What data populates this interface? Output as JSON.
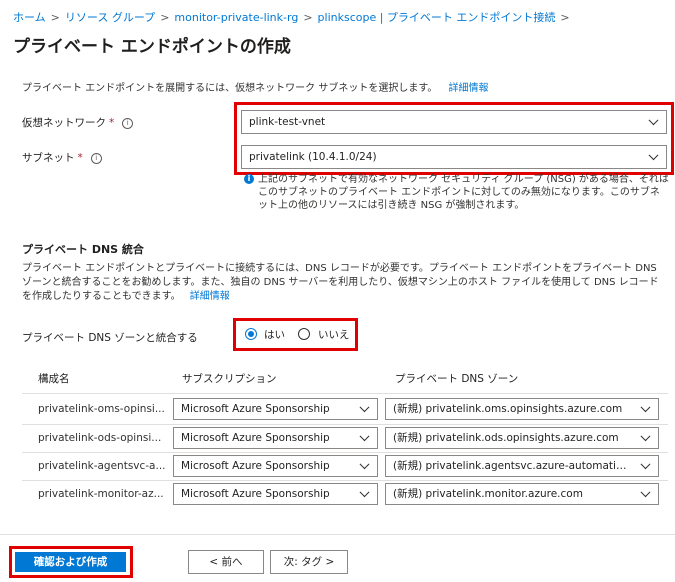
{
  "breadcrumb": {
    "items": [
      "ホーム",
      "リソース グループ",
      "monitor-private-link-rg",
      "plinkscope | プライベート エンドポイント接続"
    ],
    "separator": ">"
  },
  "page": {
    "title": "プライベート エンドポイントの作成",
    "intro": "プライベート エンドポイントを展開するには、仮想ネットワーク サブネットを選択します。",
    "learn_more": "詳細情報"
  },
  "network": {
    "vnet_label": "仮想ネットワーク",
    "vnet_value": "plink-test-vnet",
    "subnet_label": "サブネット",
    "subnet_value": "privatelink (10.4.1.0/24)",
    "required_mark": "*",
    "info_glyph": "i",
    "note": "上記のサブネットで有効なネットワーク セキュリティ グループ (NSG) がある場合、それはこのサブネットのプライベート エンドポイントに対してのみ無効になります。このサブネット上の他のリソースには引き続き NSG が強制されます。"
  },
  "dns": {
    "section_title": "プライベート DNS 統合",
    "description": "プライベート エンドポイントとプライベートに接続するには、DNS レコードが必要です。プライベート エンドポイントをプライベート DNS ゾーンと統合することをお勧めします。また、独自の DNS サーバーを利用したり、仮想マシン上のホスト ファイルを使用して DNS レコードを作成したりすることもできます。",
    "learn_more": "詳細情報",
    "integrate_label": "プライベート DNS ゾーンと統合する",
    "option_yes": "はい",
    "option_no": "いいえ",
    "selected": "yes"
  },
  "table": {
    "headers": [
      "構成名",
      "サブスクリプション",
      "プライベート DNS ゾーン"
    ],
    "rows": [
      {
        "name": "privatelink-oms-opinsi...",
        "subscription": "Microsoft Azure Sponsorship",
        "zone": "(新規) privatelink.oms.opinsights.azure.com"
      },
      {
        "name": "privatelink-ods-opinsi...",
        "subscription": "Microsoft Azure Sponsorship",
        "zone": "(新規) privatelink.ods.opinsights.azure.com"
      },
      {
        "name": "privatelink-agentsvc-a...",
        "subscription": "Microsoft Azure Sponsorship",
        "zone": "(新規) privatelink.agentsvc.azure-automation...."
      },
      {
        "name": "privatelink-monitor-az...",
        "subscription": "Microsoft Azure Sponsorship",
        "zone": "(新規) privatelink.monitor.azure.com"
      }
    ]
  },
  "footer": {
    "review_create": "確認および作成",
    "previous": "< 前へ",
    "next": "次: タグ >"
  },
  "colors": {
    "accent": "#0078d4",
    "highlight_box": "#e00000",
    "required": "#a4262c"
  }
}
